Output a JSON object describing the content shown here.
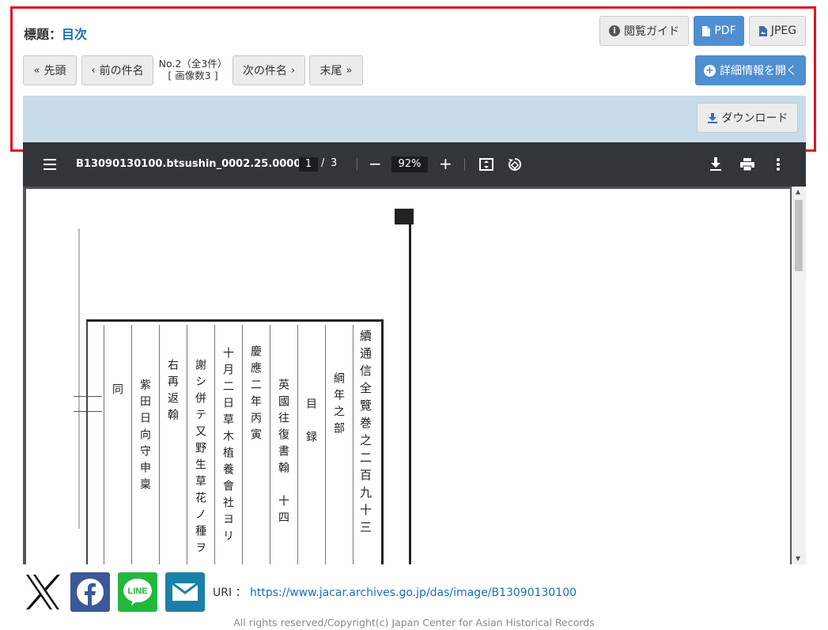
{
  "header": {
    "title_label": "標題：",
    "title_value": "目次",
    "guide_label": "閲覧ガイド",
    "pdf_label": "PDF",
    "jpeg_label": "JPEG",
    "detail_label": "詳細情報を開く"
  },
  "nav": {
    "first_label": "先頭",
    "prev_label": "前の件名",
    "counter_line1": "No.2（全3件）",
    "counter_line2": "[ 画像数3 ]",
    "next_label": "次の件名",
    "last_label": "末尾"
  },
  "band": {
    "download_label": "ダウンロード"
  },
  "viewer": {
    "filename": "B13090130100.btsushin_0002.25.0000...",
    "page_current": "1",
    "page_sep": "/",
    "page_total": "3",
    "zoom": "92%",
    "colors": {
      "toolbar_bg": "#323639",
      "page_area_bg": "#525659"
    }
  },
  "document": {
    "columns": [
      "續通信全覽巻之二百九十三",
      "綱年之部",
      "目　録",
      "英國往復書翰　十四",
      "慶應二年丙寅",
      "十月二日草木植養會社ヨリ",
      "謝シ併テ又野生草花ノ種ヲ",
      "右再返翰",
      "紫田日向守申稟",
      "同"
    ]
  },
  "footer": {
    "uri_label": "URI ：",
    "uri_value": "https://www.jacar.archives.go.jp/das/image/B13090130100",
    "copyright": "All rights reserved/Copyright(c) Japan Center for Asian Historical Records"
  },
  "social": {
    "x_icon": "x-logo-icon",
    "facebook_icon": "facebook-icon",
    "line_icon": "line-icon",
    "line_text": "LINE",
    "mail_icon": "mail-icon",
    "colors": {
      "facebook": "#3b5998",
      "line": "#21b83c",
      "mail": "#1a80a6"
    }
  },
  "colors": {
    "accent": "#4f8ed0",
    "highlight_border": "#e0141e",
    "band": "#c8dbe9"
  }
}
